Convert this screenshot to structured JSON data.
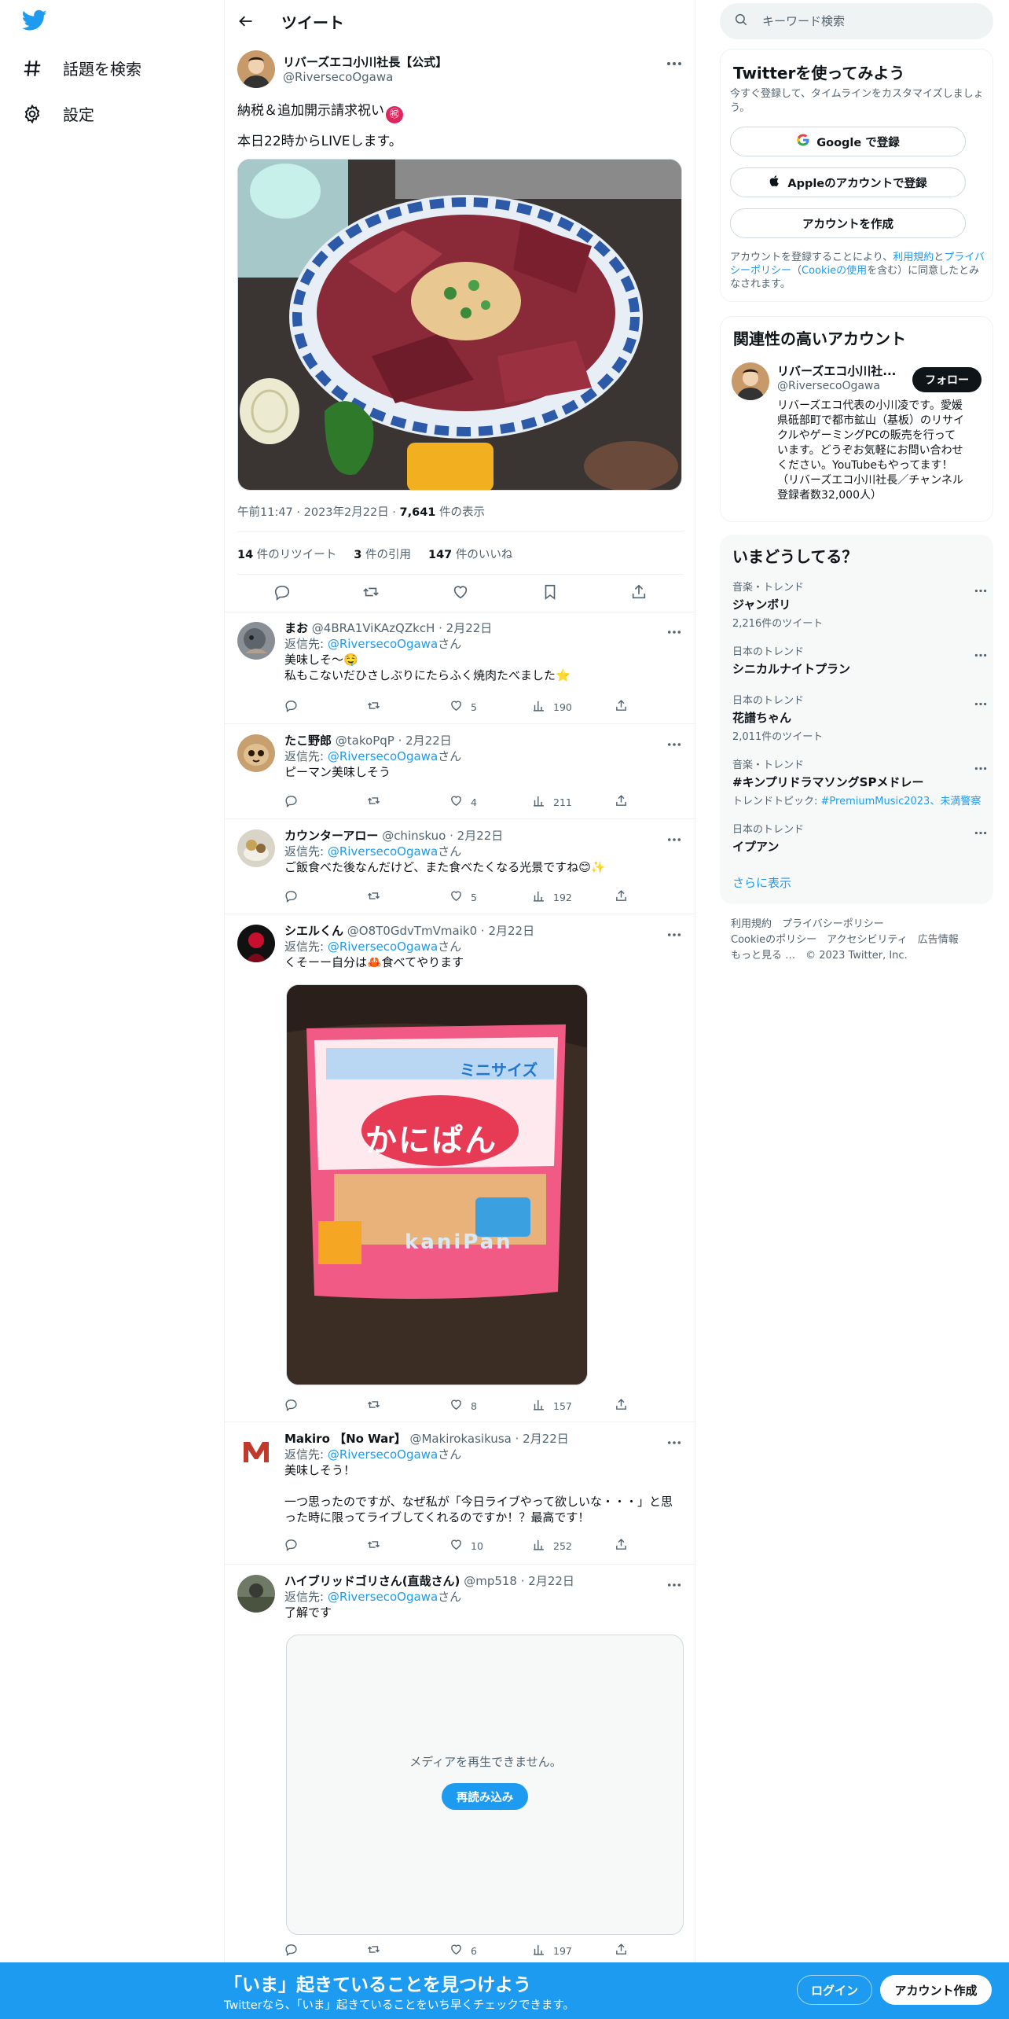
{
  "nav": {
    "explore_label": "話題を検索",
    "settings_label": "設定"
  },
  "header": {
    "title": "ツイート"
  },
  "main_tweet": {
    "author_name": "リバーズエコ小川社長【公式】",
    "author_handle": "@RiversecoOgawa",
    "text_line1": "納税＆追加開示請求祝い",
    "text_line1_emoji": "㊗",
    "text_line2": "本日22時からLIVEします。",
    "time": "午前11:47",
    "date": "2023年2月22日",
    "views": "7,641",
    "views_label": "件の表示",
    "retweets": "14",
    "retweets_label": "件のリツイート",
    "quotes": "3",
    "quotes_label": "件の引用",
    "likes": "147",
    "likes_label": "件のいいね"
  },
  "replies": [
    {
      "name": "まお",
      "handle": "@4BRA1ViKAzQZkcH",
      "date": "2月22日",
      "reply_to_prefix": "返信先: ",
      "reply_to": "@RiversecoOgawa",
      "reply_to_suffix": "さん",
      "line1": "美味しそ～🤤",
      "line2": "私もこないだひさしぶりにたらふく焼肉たべました⭐",
      "replies": "",
      "retweets": "",
      "likes": "5",
      "views": "190"
    },
    {
      "name": "たこ野郎",
      "handle": "@takoPqP",
      "date": "2月22日",
      "reply_to_prefix": "返信先: ",
      "reply_to": "@RiversecoOgawa",
      "reply_to_suffix": "さん",
      "line1": "ピーマン美味しそう",
      "replies": "",
      "retweets": "",
      "likes": "4",
      "views": "211"
    },
    {
      "name": "カウンターアロー",
      "handle": "@chinskuo",
      "date": "2月22日",
      "reply_to_prefix": "返信先: ",
      "reply_to": "@RiversecoOgawa",
      "reply_to_suffix": "さん",
      "line1": "ご飯食べた後なんだけど、また食べたくなる光景ですね😊✨",
      "replies": "",
      "retweets": "",
      "likes": "5",
      "views": "192"
    },
    {
      "name": "シエルくん",
      "handle": "@O8T0GdvTmVmaik0",
      "date": "2月22日",
      "reply_to_prefix": "返信先: ",
      "reply_to": "@RiversecoOgawa",
      "reply_to_suffix": "さん",
      "line1": "くそーー自分は🦀食べてやります",
      "photo_text_main": "かにぱん",
      "photo_text_sub": "kaniPan",
      "photo_text_badge": "ミニサイズ",
      "replies": "",
      "retweets": "",
      "likes": "8",
      "views": "157"
    },
    {
      "name": "Makiro 【No War】",
      "handle": "@Makirokasikusa",
      "date": "2月22日",
      "reply_to_prefix": "返信先: ",
      "reply_to": "@RiversecoOgawa",
      "reply_to_suffix": "さん",
      "line1": "美味しそう！",
      "line2": "一つ思ったのですが、なぜ私が「今日ライブやって欲しいな・・・」と思",
      "line3": "った時に限ってライブしてくれるのですか！？最高です！",
      "replies": "",
      "retweets": "",
      "likes": "10",
      "views": "252"
    },
    {
      "name": "ハイブリッドゴリさん(直哉さん)",
      "handle": "@mp518",
      "date": "2月22日",
      "reply_to_prefix": "返信先: ",
      "reply_to": "@RiversecoOgawa",
      "reply_to_suffix": "さん",
      "line1": "了解です",
      "media_error": "メディアを再生できません。",
      "reload_label": "再読み込み",
      "replies": "",
      "retweets": "",
      "likes": "6",
      "views": "197"
    }
  ],
  "search": {
    "placeholder": "キーワード検索"
  },
  "signup_card": {
    "title": "Twitterを使ってみよう",
    "subtitle": "今すぐ登録して、タイムラインをカスタマイズしましょう。",
    "google_label": "Google で登録",
    "apple_label": "Appleのアカウントで登録",
    "create_label": "アカウントを作成",
    "terms_prefix": "アカウントを登録することにより、",
    "terms_link": "利用規約",
    "terms_and": "と",
    "privacy_link": "プライバシーポリシー",
    "cookie_open": "（",
    "cookie_link": "Cookieの使用",
    "cookie_close": "を含む）に同意したとみなされます。"
  },
  "related": {
    "title": "関連性の高いアカウント",
    "name": "リバーズエコ小川社...",
    "handle": "@RiversecoOgawa",
    "follow_label": "フォロー",
    "bio_lines": [
      "リバーズエコ代表の小川凌です。愛媛",
      "県砥部町で都市鉱山（基板）のリサイ",
      "クルやゲーミングPCの販売を行って",
      "います。どうぞお気軽にお問い合わせ",
      "ください。YouTubeもやってます！",
      "（リバーズエコ小川社長／チャンネル",
      "登録者数32,000人）"
    ]
  },
  "trends": {
    "title": "いまどうしてる？",
    "items": [
      {
        "category": "音楽・トレンド",
        "name": "ジャンボリ",
        "count": "2,216件のツイート"
      },
      {
        "category": "日本のトレンド",
        "name": "シニカルナイトプラン",
        "count": ""
      },
      {
        "category": "日本のトレンド",
        "name": "花譜ちゃん",
        "count": "2,011件のツイート"
      },
      {
        "category": "音楽・トレンド",
        "name": "#キンプリドラマソングSPメドレー",
        "topic_prefix": "トレンドトピック: ",
        "topic": "#PremiumMusic2023、未満警察"
      },
      {
        "category": "日本のトレンド",
        "name": "イプアン",
        "count": ""
      }
    ],
    "show_more": "さらに表示"
  },
  "footer": {
    "terms": "利用規約",
    "privacy": "プライバシーポリシー",
    "cookie": "Cookieのポリシー",
    "accessibility": "アクセシビリティ",
    "ads": "広告情報",
    "more": "もっと見る …",
    "copyright": "© 2023 Twitter, Inc."
  },
  "bottom_bar": {
    "title": "「いま」起きていることを見つけよう",
    "subtitle": "Twitterなら、「いま」起きていることをいち早くチェックできます。",
    "login_label": "ログイン",
    "signup_label": "アカウント作成"
  },
  "colors": {
    "accent": "#1d9bf0",
    "text": "#0f1419",
    "muted": "#536471"
  }
}
